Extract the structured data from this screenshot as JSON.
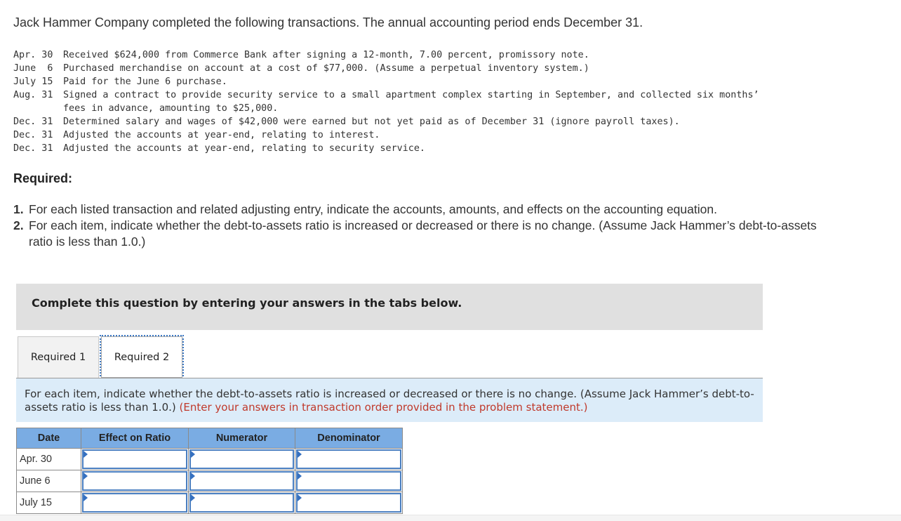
{
  "intro": "Jack Hammer Company completed the following transactions. The annual accounting period ends December 31.",
  "transactions": [
    {
      "date": "Apr. 30",
      "text": "Received $624,000 from Commerce Bank after signing a 12-month, 7.00 percent, promissory note."
    },
    {
      "date": "June  6",
      "text": "Purchased merchandise on account at a cost of $77,000. (Assume a perpetual inventory system.)"
    },
    {
      "date": "July 15",
      "text": "Paid for the June 6 purchase."
    },
    {
      "date": "Aug. 31",
      "text": "Signed a contract to provide security service to a small apartment complex starting in September, and collected six months’"
    },
    {
      "date": "",
      "text": "fees in advance, amounting to $25,000."
    },
    {
      "date": "Dec. 31",
      "text": "Determined salary and wages of $42,000 were earned but not yet paid as of December 31 (ignore payroll taxes)."
    },
    {
      "date": "Dec. 31",
      "text": "Adjusted the accounts at year-end, relating to interest."
    },
    {
      "date": "Dec. 31",
      "text": "Adjusted the accounts at year-end, relating to security service."
    }
  ],
  "required_heading": "Required:",
  "requirements": [
    {
      "num": "1.",
      "text": "For each listed transaction and related adjusting entry, indicate the accounts, amounts, and effects on the accounting equation."
    },
    {
      "num": "2.",
      "text": "For each item, indicate whether the debt-to-assets ratio is increased or decreased or there is no change. (Assume Jack Hammer’s debt-to-assets ratio is less than 1.0.)"
    }
  ],
  "banner": "Complete this question by entering your answers in the tabs below.",
  "tabs": [
    {
      "label": "Required 1"
    },
    {
      "label": "Required 2",
      "active": true
    }
  ],
  "instructions": "For each item, indicate whether the debt-to-assets ratio is increased or decreased or there is no change. (Assume Jack Hammer’s debt-to-assets ratio is less than 1.0.)",
  "instructions_note": "(Enter your answers in transaction order provided in the problem statement.)",
  "table": {
    "headers": [
      "Date",
      "Effect on Ratio",
      "Numerator",
      "Denominator"
    ],
    "rows": [
      {
        "date": "Apr. 30",
        "effect": "",
        "numerator": "",
        "denominator": ""
      },
      {
        "date": "June 6",
        "effect": "",
        "numerator": "",
        "denominator": ""
      },
      {
        "date": "July 15",
        "effect": "",
        "numerator": "",
        "denominator": ""
      }
    ]
  },
  "colors": {
    "header_blue": "#7aace3",
    "instr_bg": "#dcecf9",
    "note_red": "#c0392b",
    "input_border": "#4a7fc1"
  }
}
